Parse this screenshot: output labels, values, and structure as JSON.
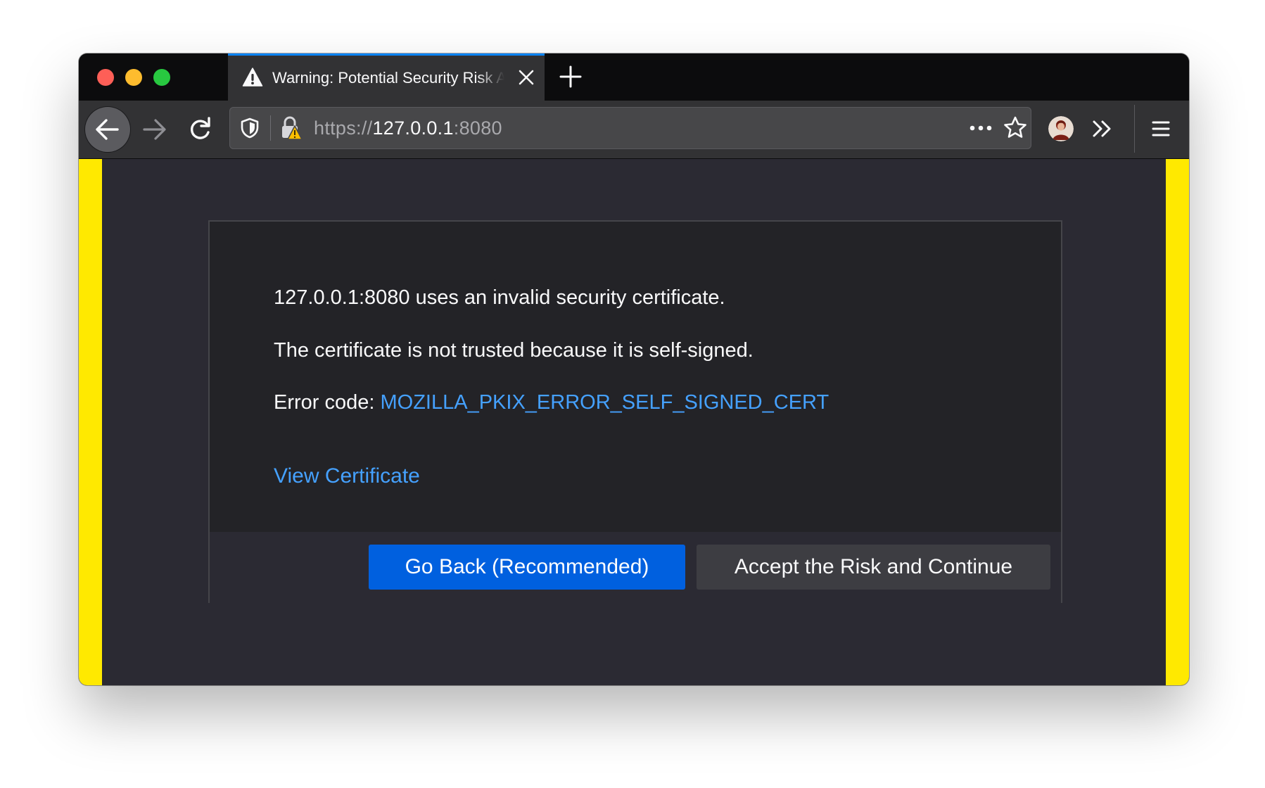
{
  "window": {
    "title": "Warning: Potential Security Risk Ahead"
  },
  "tab": {
    "title": "Warning: Potential Security Risk Ahead",
    "icon": "warning-icon",
    "close_icon": "close-icon",
    "new_tab_icon": "plus-icon"
  },
  "toolbar": {
    "back_icon": "arrow-left-icon",
    "forward_icon": "arrow-right-icon",
    "reload_icon": "reload-icon",
    "overflow_icon": "chevron-double-right-icon",
    "menu_icon": "hamburger-menu-icon",
    "avatar_icon": "account-avatar"
  },
  "urlbar": {
    "scheme": "https://",
    "host": "127.0.0.1",
    "port": ":8080",
    "shield_icon": "tracking-protection-shield-icon",
    "lock_icon": "insecure-lock-warning-icon",
    "more_icon": "page-actions-ellipsis-icon",
    "star_icon": "bookmark-star-icon"
  },
  "error_page": {
    "line_invalid_cert": "127.0.0.1:8080 uses an invalid security certificate.",
    "line_self_signed": "The certificate is not trusted because it is self-signed.",
    "error_code_label": "Error code: ",
    "error_code": "MOZILLA_PKIX_ERROR_SELF_SIGNED_CERT",
    "view_certificate": "View Certificate",
    "go_back_button": "Go Back (Recommended)",
    "accept_button": "Accept the Risk and Continue"
  },
  "colors": {
    "accent_blue": "#0060df",
    "link_blue": "#45a1ff",
    "warning_stripe": "#ffe900",
    "content_bg": "#2b2a33",
    "panel_bg": "#232327"
  }
}
